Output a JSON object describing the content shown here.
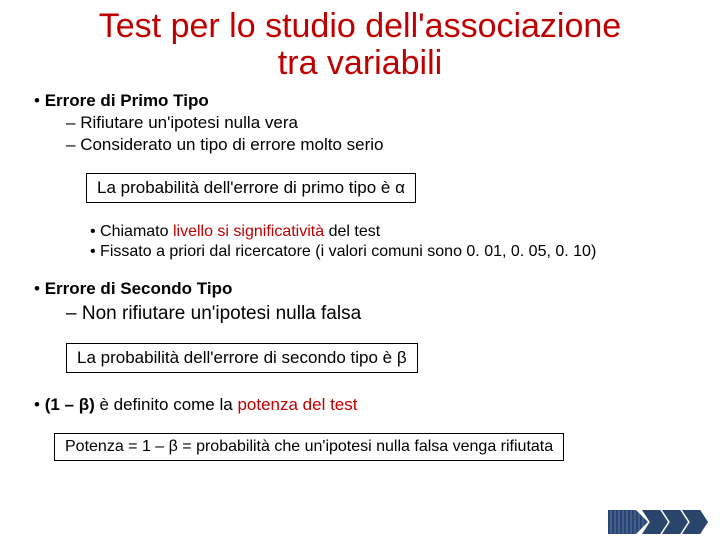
{
  "title_line1": "Test per lo studio dell'associazione",
  "title_line2": "tra variabili",
  "sec1": {
    "heading": "Errore di Primo Tipo",
    "sub1": "Rifiutare un'ipotesi nulla vera",
    "sub2": "Considerato un tipo di errore molto serio",
    "box": "La probabilità dell'errore di primo tipo è α",
    "p1_a": "Chiamato ",
    "p1_hl": "livello si significatività",
    "p1_b": " del test",
    "p2": "Fissato a priori dal ricercatore (i valori comuni sono 0. 01, 0. 05, 0. 10)"
  },
  "sec2": {
    "heading": "Errore di Secondo Tipo",
    "sub1": "Non rifiutare un'ipotesi nulla falsa",
    "box": "La probabilità dell'errore di secondo tipo è  β"
  },
  "sec3": {
    "p_a": "(1 – β)",
    "p_b": " è definito come la ",
    "p_hl": "potenza del test",
    "box": "Potenza = 1 – β = probabilità che un'ipotesi nulla falsa venga rifiutata"
  }
}
